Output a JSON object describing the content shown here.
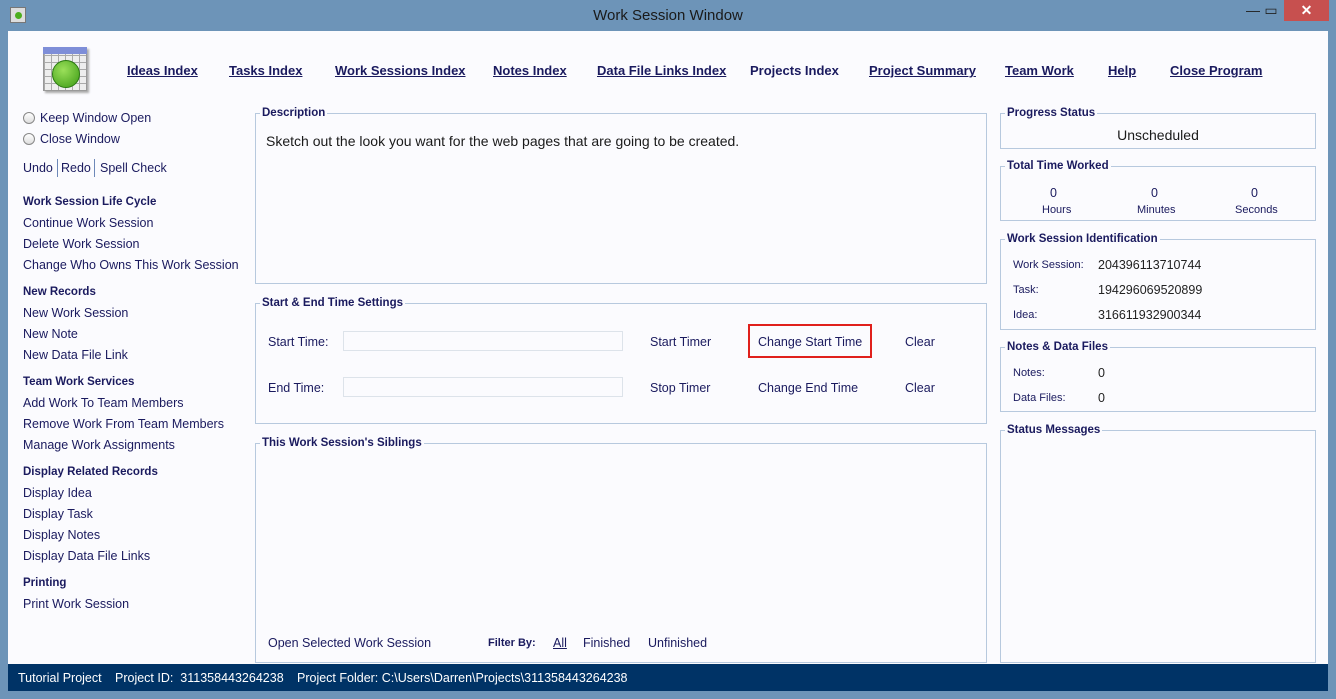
{
  "window": {
    "title": "Work Session Window",
    "minimize": "—",
    "maximize": "▭",
    "close": "✕"
  },
  "nav": [
    "Ideas Index",
    "Tasks Index",
    "Work Sessions Index",
    "Notes Index",
    "Data File Links Index",
    "Projects Index",
    "Project Summary",
    "Team Work",
    "Help",
    "Close Program"
  ],
  "options": {
    "keep_open": "Keep Window Open",
    "close_window": "Close Window",
    "selected": "none"
  },
  "edit": {
    "undo": "Undo",
    "redo": "Redo",
    "spell": "Spell Check"
  },
  "sidebar": [
    {
      "heading": "Work Session Life Cycle",
      "items": [
        "Continue Work Session",
        "Delete Work Session",
        "Change Who Owns This Work Session"
      ]
    },
    {
      "heading": "New Records",
      "items": [
        "New Work Session",
        "New Note",
        "New Data File Link"
      ]
    },
    {
      "heading": "Team Work Services",
      "items": [
        "Add Work To Team Members",
        "Remove Work From Team Members",
        "Manage Work Assignments"
      ]
    },
    {
      "heading": "Display Related Records",
      "items": [
        "Display Idea",
        "Display Task",
        "Display Notes",
        "Display Data File Links"
      ]
    },
    {
      "heading": "Printing",
      "items": [
        "Print Work Session"
      ]
    }
  ],
  "description": {
    "legend": "Description",
    "text": "Sketch out the look you want for the web pages that are going to be created."
  },
  "times": {
    "legend": "Start & End Time Settings",
    "start_label": "Start Time:",
    "start_value": "",
    "end_label": "End Time:",
    "end_value": "",
    "start_timer": "Start Timer",
    "stop_timer": "Stop Timer",
    "change_start": "Change Start Time",
    "change_end": "Change End Time",
    "clear": "Clear",
    "highlight_color": "#e0201c"
  },
  "siblings": {
    "legend": "This Work Session's Siblings",
    "open": "Open Selected Work Session",
    "filter_label": "Filter By:",
    "filters": [
      "All",
      "Finished",
      "Unfinished"
    ]
  },
  "progress": {
    "legend": "Progress Status",
    "value": "Unscheduled"
  },
  "time_worked": {
    "legend": "Total Time Worked",
    "hours": "0",
    "hours_label": "Hours",
    "minutes": "0",
    "minutes_label": "Minutes",
    "seconds": "0",
    "seconds_label": "Seconds"
  },
  "ident": {
    "legend": "Work Session Identification",
    "ws_label": "Work Session:",
    "ws": "204396113710744",
    "task_label": "Task:",
    "task": "194296069520899",
    "idea_label": "Idea:",
    "idea": "316611932900344"
  },
  "notes": {
    "legend": "Notes & Data Files",
    "notes_label": "Notes:",
    "notes": "0",
    "files_label": "Data Files:",
    "files": "0"
  },
  "messages": {
    "legend": "Status Messages"
  },
  "status": {
    "project": "Tutorial Project",
    "project_id": "Project ID:  311358443264238",
    "folder": "Project Folder: C:\\Users\\Darren\\Projects\\311358443264238"
  }
}
